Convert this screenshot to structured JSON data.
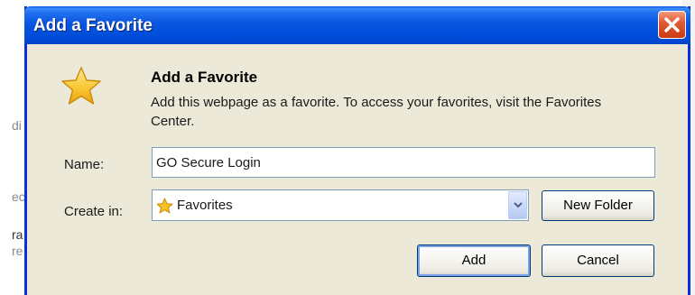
{
  "background": {
    "fragments": [
      "di",
      "ec",
      "ra",
      "re"
    ]
  },
  "dialog": {
    "title": "Add a Favorite",
    "close_icon": "close-x-icon",
    "heading": "Add a Favorite",
    "description": "Add this webpage as a favorite. To access your favorites, visit the Favorites Center.",
    "star_icon": "favorites-star-icon",
    "name": {
      "label": "Name:",
      "value": "GO Secure Login"
    },
    "create_in": {
      "label": "Create in:",
      "selected": "Favorites",
      "folder_icon": "favorites-star-icon",
      "dropdown_icon": "chevron-down-icon"
    },
    "buttons": {
      "new_folder": "New Folder",
      "add": "Add",
      "cancel": "Cancel"
    }
  },
  "colors": {
    "titlebar": "#0050dc",
    "dialog_bg": "#ece9d8",
    "close_button": "#e25b35",
    "star": "#f7c325"
  }
}
